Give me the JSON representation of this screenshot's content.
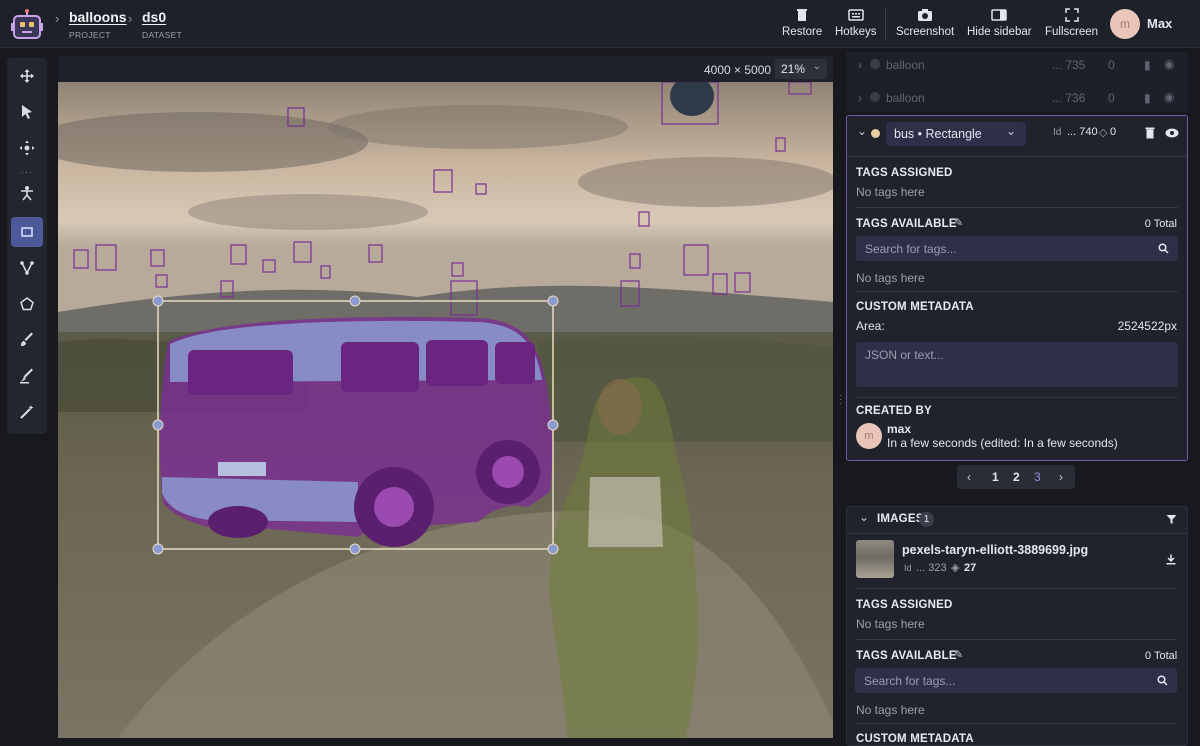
{
  "breadcrumb": {
    "project": {
      "name": "balloons",
      "type": "PROJECT"
    },
    "dataset": {
      "name": "ds0",
      "type": "DATASET"
    }
  },
  "toolbar_buttons": [
    {
      "label": "Restore",
      "icon": "trash-icon"
    },
    {
      "label": "Hotkeys",
      "icon": "keyboard-icon"
    },
    {
      "label": "Screenshot",
      "icon": "camera-icon"
    },
    {
      "label": "Hide sidebar",
      "icon": "sidebar-icon"
    },
    {
      "label": "Fullscreen",
      "icon": "fullscreen-icon"
    }
  ],
  "user": {
    "initial": "m",
    "name": "Max"
  },
  "tools": [
    "move-icon",
    "cursor-icon",
    "pan-icon",
    "keypoints-icon",
    "rectangle-icon",
    "polyline-icon",
    "polygon-icon",
    "brush-icon",
    "eraser-icon",
    "magic-wand-icon"
  ],
  "canvas": {
    "dimensions": "4000 × 5000",
    "zoom": "21%"
  },
  "objects_above": [
    {
      "class": "balloon",
      "id": "... 735",
      "tags": "0"
    },
    {
      "class": "balloon",
      "id": "... 736",
      "tags": "0"
    }
  ],
  "selected_object": {
    "class_label": "bus • Rectangle",
    "id": "... 740",
    "tags_count": "0",
    "tags_assigned_title": "TAGS ASSIGNED",
    "tags_assigned_empty": "No tags here",
    "tags_available_title": "TAGS AVAILABLE",
    "tags_available_total": "0 Total",
    "search_placeholder": "Search for tags...",
    "tags_available_empty": "No tags here",
    "custom_metadata_title": "CUSTOM METADATA",
    "area_label": "Area:",
    "area_value": "2524522px",
    "metadata_placeholder": "JSON or text...",
    "created_by_title": "CREATED BY",
    "creator_initial": "m",
    "creator_name": "max",
    "created_time": "In a few seconds (edited: In a few seconds)"
  },
  "pagination": {
    "pages": [
      "1",
      "2",
      "3"
    ]
  },
  "images": {
    "title": "IMAGES",
    "count": "1",
    "file_name": "pexels-taryn-elliott-3889699.jpg",
    "id": "... 323",
    "objects": "27",
    "tags_assigned_title": "TAGS ASSIGNED",
    "tags_assigned_empty": "No tags here",
    "tags_available_title": "TAGS AVAILABLE",
    "tags_available_total": "0 Total",
    "search_placeholder": "Search for tags...",
    "tags_available_empty": "No tags here",
    "custom_metadata_title": "CUSTOM METADATA"
  },
  "colors": {
    "accent": "#6b5ba8",
    "bus_fill": "#7a2f93",
    "bus_box": "#e8dcc0",
    "person_mask": "#6f7d3a",
    "balloon_box": "#7a2f93"
  }
}
